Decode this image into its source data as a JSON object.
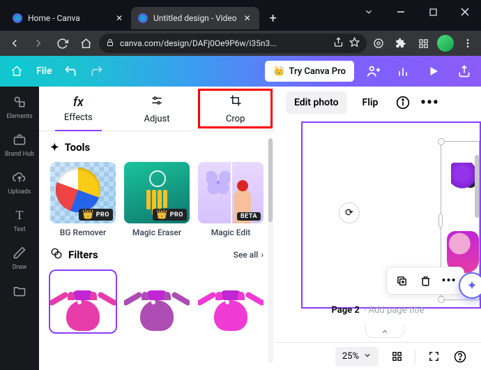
{
  "browser": {
    "tabs": [
      {
        "title": "Home - Canva"
      },
      {
        "title": "Untitled design - Video"
      }
    ],
    "url": "canva.com/design/DAFj0Oe9P6w/i35n3..."
  },
  "appbar": {
    "file": "File",
    "try_pro": "Try Canva Pro"
  },
  "rail": {
    "elements": "Elements",
    "brandhub": "Brand Hub",
    "uploads": "Uploads",
    "text": "Text",
    "draw": "Draw"
  },
  "panel": {
    "tabs": {
      "effects": "Effects",
      "adjust": "Adjust",
      "crop": "Crop"
    },
    "tools": {
      "heading": "Tools",
      "items": [
        "BG Remover",
        "Magic Eraser",
        "Magic Edit"
      ],
      "pro_badge": "PRO",
      "beta_badge": "BETA"
    },
    "filters": {
      "heading": "Filters",
      "see_all": "See all"
    }
  },
  "canvas": {
    "edit_photo": "Edit photo",
    "flip": "Flip",
    "page_label": "Page 2",
    "add_title": "- Add page title"
  },
  "status": {
    "zoom": "25%"
  }
}
